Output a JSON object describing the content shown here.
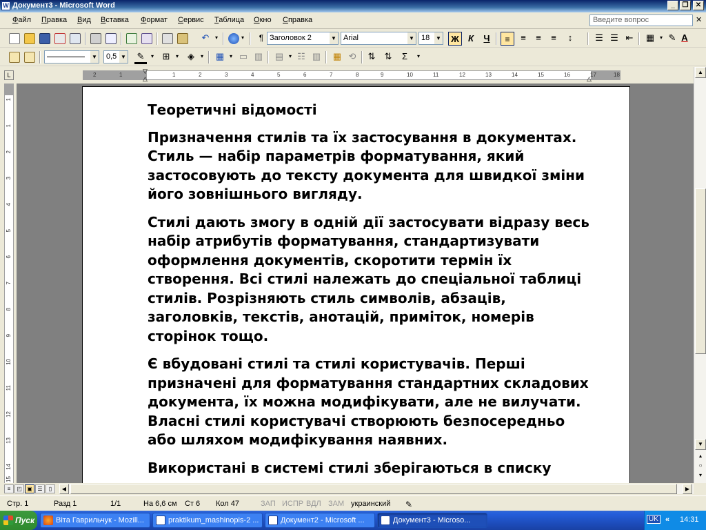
{
  "window": {
    "title": "Документ3 - Microsoft Word"
  },
  "menu": [
    "Файл",
    "Правка",
    "Вид",
    "Вставка",
    "Формат",
    "Сервис",
    "Таблица",
    "Окно",
    "Справка"
  ],
  "ask_placeholder": "Введите вопрос",
  "formatting": {
    "style": "Заголовок 2",
    "font": "Arial",
    "size": "18",
    "bold": "Ж",
    "italic": "К",
    "underline": "Ч"
  },
  "drawing": {
    "line_weight": "0,5"
  },
  "ruler": {
    "h_ticks": [
      "2",
      "1",
      "1",
      "2",
      "3",
      "4",
      "5",
      "6",
      "7",
      "8",
      "9",
      "10",
      "11",
      "12",
      "13",
      "14",
      "15",
      "16",
      "17",
      "18"
    ],
    "v_ticks": [
      "1",
      "1",
      "2",
      "3",
      "4",
      "5",
      "6",
      "7",
      "8",
      "9",
      "10",
      "11",
      "12",
      "13",
      "14",
      "15"
    ]
  },
  "document": {
    "heading": "Теоретичні відомості",
    "paragraphs": [
      "Призначення стилів та їх застосування в документах. Стиль — набір параметрів форматування, який застосовують до тексту документа для швидкої зміни його зовнішнього вигляду.",
      "Стилі дають змогу в одній дії застосувати відразу весь набір атрибутів форматування, стандартизувати оформлення документів, скоротити термін їх створення. Всі стилі належать до спеціальної таблиці стилів. Розрізняють стиль символів, абзаців, заголовків, текстів, анотацій, приміток, номерів сторінок тощо.",
      "Є вбудовані стилі та стилі користувачів. Перші призначені для форматування стандартних складових документа, їх можна модифікувати, але не вилучати. Власні стилі користувачі створюють безпосередньо або шляхом модифікування наявних.",
      "Використані в системі стилі зберігаються в списку"
    ]
  },
  "status": {
    "page": "Стр. 1",
    "section": "Разд 1",
    "pages": "1/1",
    "at": "На 6,6 см",
    "line": "Ст 6",
    "col": "Кол 47",
    "rec": "ЗАП",
    "trk": "ИСПР",
    "ext": "ВДЛ",
    "ovr": "ЗАМ",
    "lang": "украинский"
  },
  "taskbar": {
    "start": "Пуск",
    "tasks": [
      "Віта Гаврильчук - Mozill...",
      "praktikum_mashinopis-2 ...",
      "Документ2 - Microsoft ...",
      "Документ3 - Microso..."
    ],
    "lang": "UK",
    "clock": "14:31"
  },
  "colors": {
    "title_bar": "#0a246a",
    "taskbar": "#245edb",
    "start": "#3c9a3c",
    "page": "#ffffff",
    "doc_bg": "#808080"
  }
}
